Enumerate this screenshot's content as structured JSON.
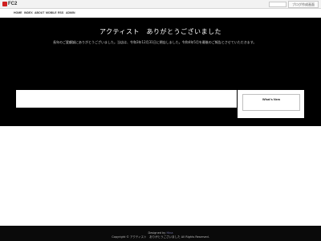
{
  "fc2": {
    "logo_text": "FC2",
    "button_label": "ブログ作成画面"
  },
  "nav": {
    "items": [
      {
        "label": "HOME"
      },
      {
        "label": "INDEX"
      },
      {
        "label": "ABOUT"
      },
      {
        "label": "MOBILE"
      },
      {
        "label": "RSS"
      },
      {
        "label": "ADMIN"
      }
    ]
  },
  "main": {
    "title": "アクティスト　ありがとうございました",
    "notice": "長年のご愛顧誠にありがとうございました。当店は、令和3年12月31日に閉店しました。令和4年5月を最後のご報告とさせていただきます。"
  },
  "sidebar": {
    "whats_new": "What's New"
  },
  "footer": {
    "designed_by": "Designed by",
    "designer": "Hina",
    "copyright": "Copyright © アクティスト　ありがとうございました All Rights Reserved."
  },
  "colors": {
    "background": "#000000",
    "fc2_red": "#d02020",
    "footer": "#0a0a0a"
  }
}
